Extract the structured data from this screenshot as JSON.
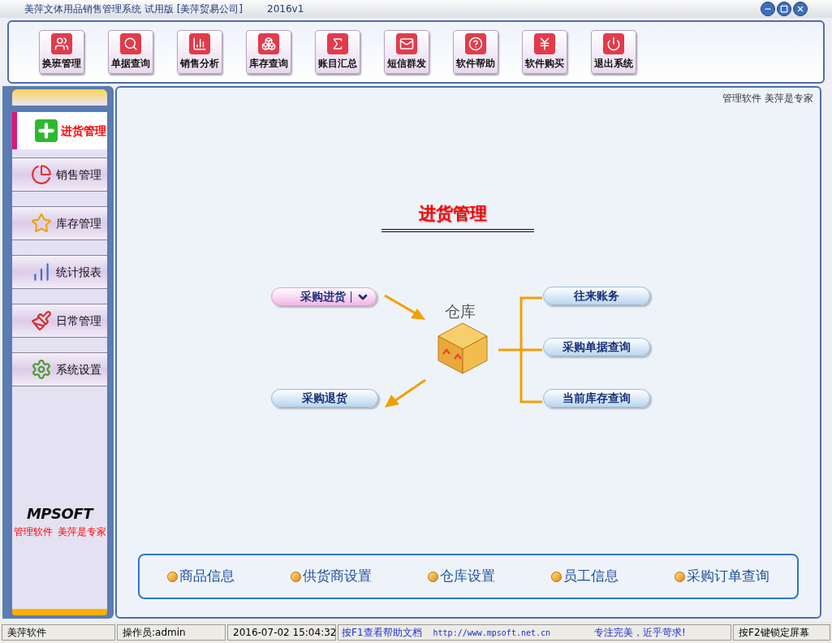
{
  "window": {
    "title": "美萍文体用品销售管理系统 试用版 [美萍贸易公司]",
    "version": "2016v1"
  },
  "toolbar": [
    {
      "label": "换班管理"
    },
    {
      "label": "单据查询"
    },
    {
      "label": "销售分析"
    },
    {
      "label": "库存查询"
    },
    {
      "label": "账目汇总"
    },
    {
      "label": "短信群发"
    },
    {
      "label": "软件帮助"
    },
    {
      "label": "软件购买"
    },
    {
      "label": "退出系统"
    }
  ],
  "sidebar": {
    "items": [
      {
        "label": "进货管理",
        "selected": true
      },
      {
        "label": "销售管理",
        "selected": false
      },
      {
        "label": "库存管理",
        "selected": false
      },
      {
        "label": "统计报表",
        "selected": false
      },
      {
        "label": "日常管理",
        "selected": false
      },
      {
        "label": "系统设置",
        "selected": false
      }
    ],
    "logo": "MPSOFT",
    "slogan": [
      "管理软件",
      "美萍是专家"
    ]
  },
  "content": {
    "tagline": "管理软件 美萍是专家",
    "heading": "进货管理",
    "center_label": "仓库",
    "left_buttons": [
      {
        "label": "采购进货",
        "kind": "dropdown"
      },
      {
        "label": "采购退货",
        "kind": "plain"
      }
    ],
    "right_buttons": [
      {
        "label": "往来账务"
      },
      {
        "label": "采购单据查询"
      },
      {
        "label": "当前库存查询"
      }
    ],
    "quick_links": [
      {
        "label": "商品信息"
      },
      {
        "label": "供货商设置"
      },
      {
        "label": "仓库设置"
      },
      {
        "label": "员工信息"
      },
      {
        "label": "采购订单查询"
      }
    ]
  },
  "status_bar": {
    "cells": [
      "美萍软件",
      "操作员:admin",
      "2016-07-02 15:04:32"
    ],
    "messages": [
      "按F1查看帮助文档",
      "http://www.mpsoft.net.cn",
      "专注完美，近乎苛求!"
    ],
    "right": "按F2键锁定屏幕"
  }
}
